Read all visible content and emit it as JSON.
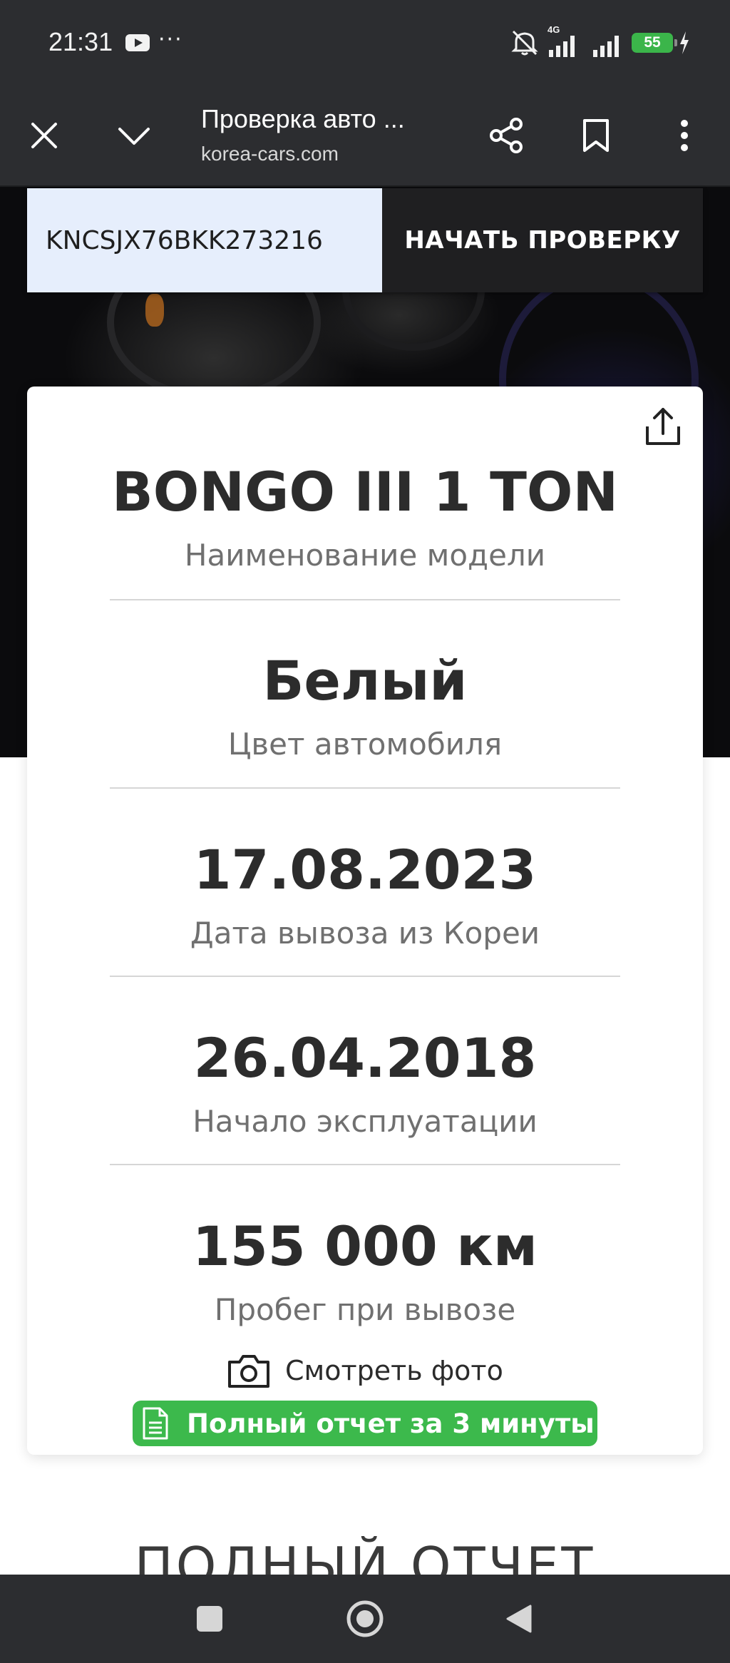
{
  "status_bar": {
    "time": "21:31",
    "more": "···",
    "network": "4G",
    "battery": "55",
    "icons": [
      "youtube-icon",
      "mute-icon",
      "signal-icon",
      "signal-icon",
      "battery-icon",
      "charging-icon"
    ]
  },
  "browser": {
    "page_title": "Проверка авто ...",
    "url": "korea-cars.com",
    "icons": [
      "close-icon",
      "chevron-down-icon",
      "share-icon",
      "bookmark-icon",
      "more-vert-icon"
    ]
  },
  "vin_search": {
    "value": "KNCSJX76BKK273216",
    "button_label": "НАЧАТЬ ПРОВЕРКУ"
  },
  "card": {
    "fields": [
      {
        "value": "BONGO III 1 TON",
        "label": "Наименование модели"
      },
      {
        "value": "Белый",
        "label": "Цвет автомобиля"
      },
      {
        "value": "17.08.2023",
        "label": "Дата вывоза из Кореи"
      },
      {
        "value": "26.04.2018",
        "label": "Начало эксплуатации"
      },
      {
        "value": "155 000 км",
        "label": "Пробег при вывозе"
      }
    ],
    "photo_link": "Смотреть фото",
    "report_button": "Полный отчет за 3 минуты",
    "report_color": "#3cb94c"
  },
  "section_heading": "ПОЛНЫЙ ОТЧЕТ",
  "nav_bar": {
    "icons": [
      "recents-icon",
      "home-icon",
      "back-icon"
    ]
  }
}
